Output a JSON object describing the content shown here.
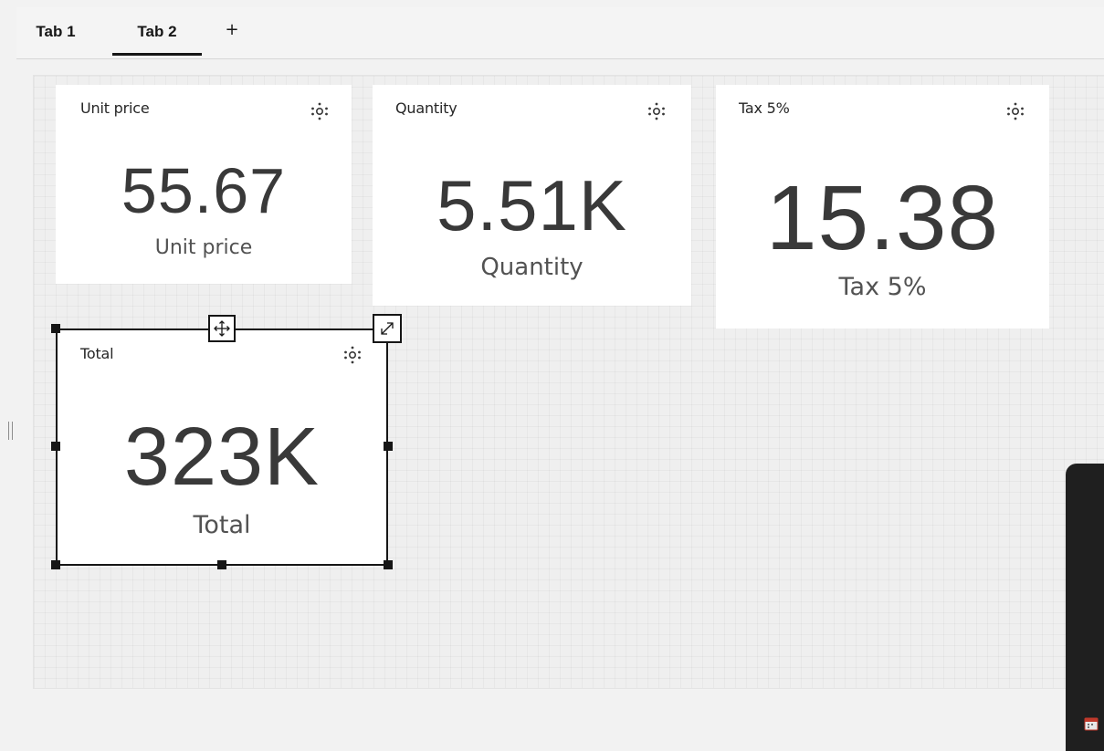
{
  "tabs": [
    {
      "label": "Tab 1",
      "active": false
    },
    {
      "label": "Tab 2",
      "active": true
    }
  ],
  "add_tab_label": "+",
  "widgets": {
    "unit_price": {
      "title": "Unit price",
      "value": "55.67",
      "label": "Unit price",
      "icon": "settings-sparkle-icon"
    },
    "quantity": {
      "title": "Quantity",
      "value": "5.51K",
      "label": "Quantity",
      "icon": "settings-sparkle-icon"
    },
    "tax": {
      "title": "Tax 5%",
      "value": "15.38",
      "label": "Tax 5%",
      "icon": "settings-sparkle-icon"
    },
    "total": {
      "title": "Total",
      "value": "323K",
      "label": "Total",
      "icon": "settings-sparkle-icon",
      "selected": true
    }
  },
  "selection_controls": {
    "move_icon": "move-arrows-icon",
    "resize_icon": "expand-diagonal-icon"
  },
  "colors": {
    "canvas_bg": "#efefef",
    "widget_bg": "#ffffff",
    "text_primary": "#161616",
    "kpi_value": "#393939",
    "side_panel": "#1f1f1f"
  }
}
